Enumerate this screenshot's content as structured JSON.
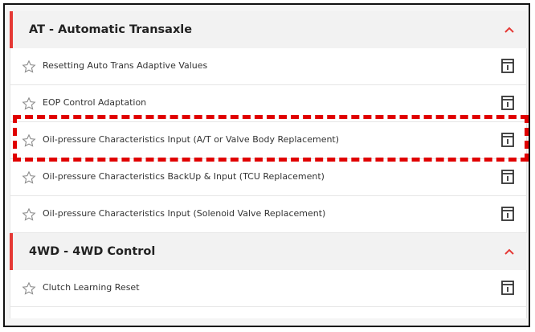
{
  "sections": [
    {
      "title": "AT - Automatic Transaxle",
      "items": [
        {
          "label": "Resetting Auto Trans Adaptive Values"
        },
        {
          "label": "EOP Control Adaptation"
        },
        {
          "label": "Oil-pressure Characteristics Input (A/T or Valve Body Replacement)"
        },
        {
          "label": "Oil-pressure Characteristics BackUp & Input (TCU Replacement)"
        },
        {
          "label": "Oil-pressure Characteristics Input (Solenoid Valve Replacement)"
        }
      ]
    },
    {
      "title": "4WD - 4WD Control",
      "items": [
        {
          "label": "Clutch Learning Reset"
        }
      ]
    }
  ],
  "colors": {
    "accent": "#e53935",
    "highlight": "#e00000"
  },
  "icons": {
    "favorite": "star-outline-icon",
    "doc": "document-icon",
    "collapse": "chevron-up-icon"
  }
}
